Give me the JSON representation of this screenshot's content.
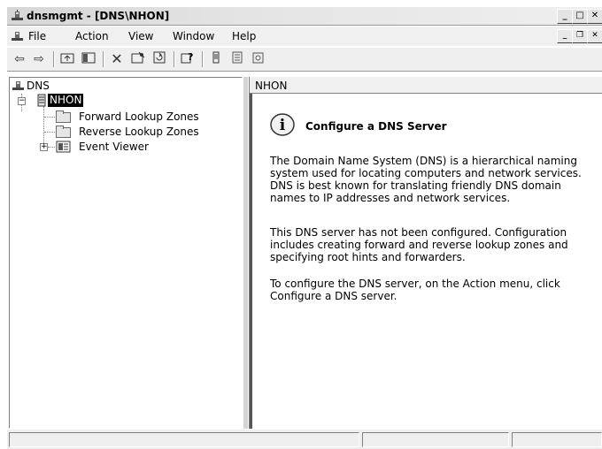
{
  "window": {
    "title": "dnsmgmt - [DNS\\NHON]",
    "controls": [
      "minimize-icon",
      "restore-icon",
      "close-icon"
    ]
  },
  "menubar": {
    "items": [
      {
        "label": "File"
      },
      {
        "label": "Action"
      },
      {
        "label": "View"
      },
      {
        "label": "Window"
      },
      {
        "label": "Help"
      }
    ]
  },
  "toolbar": {
    "buttons": [
      "back-icon",
      "forward-icon",
      "up-icon",
      "show-hide-tree-icon",
      "delete-icon",
      "properties-icon",
      "refresh-icon",
      "help-icon",
      "server-list-icon",
      "detail-icon",
      "export-icon"
    ]
  },
  "tree": {
    "root": "DNS",
    "server": "NHON",
    "children": [
      {
        "label": "Forward Lookup Zones"
      },
      {
        "label": "Reverse Lookup Zones"
      },
      {
        "label": "Event Viewer"
      }
    ]
  },
  "details": {
    "header": "NHON",
    "heading": "Configure a DNS Server",
    "paragraphs": [
      "The Domain Name System (DNS) is a hierarchical naming system used for locating computers and network services. DNS is best known for translating friendly DNS domain names to IP addresses and network services.",
      "This DNS server has not been configured. Configuration includes creating forward and reverse lookup zones and specifying root hints and forwarders.",
      "To configure the DNS server, on the Action menu, click Configure a DNS server."
    ]
  },
  "status": {
    "panels": [
      "",
      "",
      ""
    ]
  }
}
